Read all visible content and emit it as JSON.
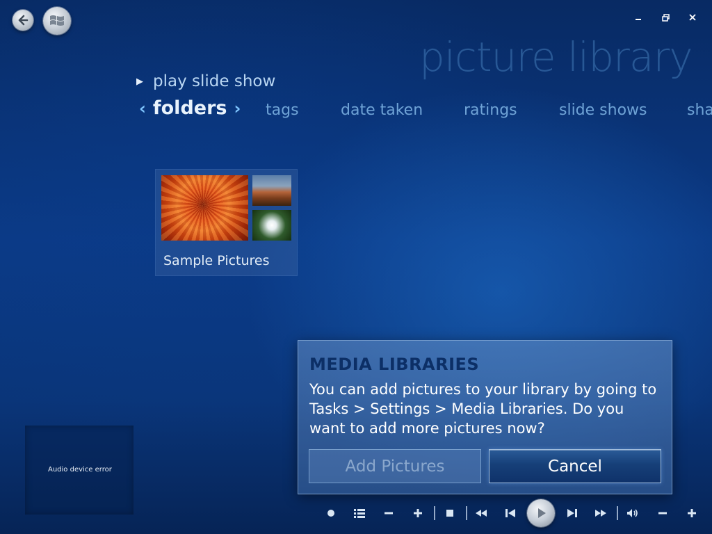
{
  "window": {
    "title": "picture library",
    "controls": {
      "minimize_icon": "minimize-icon",
      "restore_icon": "restore-icon",
      "close_icon": "close-icon"
    }
  },
  "top_buttons": {
    "back_icon": "back-arrow-icon",
    "start_icon": "windows-logo-icon"
  },
  "actions": {
    "play_slide_show": "play slide show"
  },
  "nav": {
    "selected": "folders",
    "items": [
      "tags",
      "date taken",
      "ratings",
      "slide shows",
      "sha"
    ]
  },
  "library": {
    "folders": [
      {
        "name": "Sample Pictures"
      }
    ]
  },
  "status": {
    "audio_error": "Audio device error"
  },
  "dialog": {
    "title": "MEDIA LIBRARIES",
    "message": "You can add pictures to your library by going to Tasks > Settings > Media Libraries. Do you want to add more pictures now?",
    "add_button": "Add Pictures",
    "cancel_button": "Cancel"
  },
  "transport": {
    "icons": [
      "record-icon",
      "guide-icon",
      "channel-down-icon",
      "channel-up-icon",
      "stop-icon",
      "rewind-icon",
      "previous-icon",
      "play-icon",
      "next-icon",
      "fast-forward-icon",
      "volume-icon",
      "volume-down-icon",
      "volume-up-icon"
    ]
  },
  "colors": {
    "background": "#0b3a86",
    "accent": "#7fc6ff",
    "dialog_title": "#0c2f66"
  }
}
